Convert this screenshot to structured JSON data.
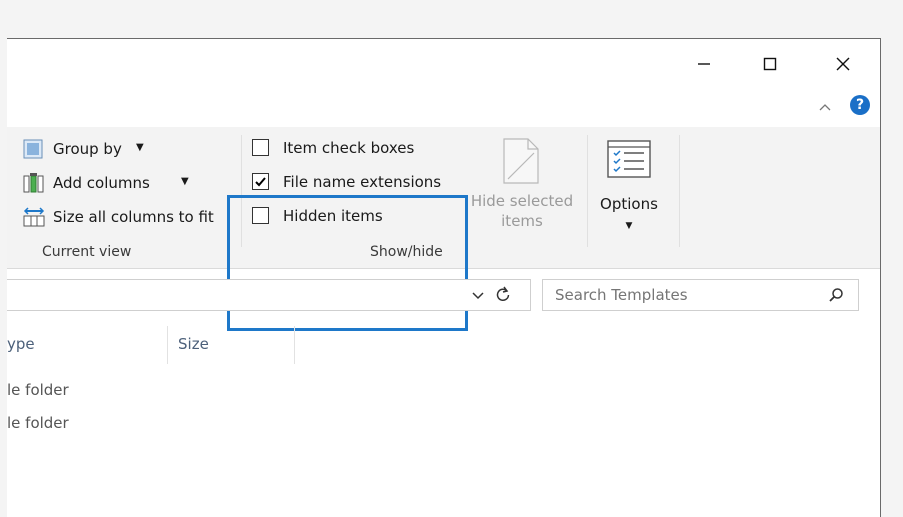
{
  "window": {
    "controls": {
      "minimize": "minimize-icon",
      "maximize": "maximize-icon",
      "close": "close-icon"
    },
    "collapse_icon": "chevron-up-icon",
    "help_icon": "?"
  },
  "ribbon": {
    "current_view": {
      "group_by": "Group by",
      "add_columns": "Add columns",
      "size_all": "Size all columns to fit",
      "label": "Current view"
    },
    "show_hide": {
      "item_check_boxes": {
        "label": "Item check boxes",
        "checked": false
      },
      "file_name_extensions": {
        "label": "File name extensions",
        "checked": true
      },
      "hidden_items": {
        "label": "Hidden items",
        "checked": false
      },
      "hide_selected_line1": "Hide selected",
      "hide_selected_line2": "items",
      "label": "Show/hide"
    },
    "options": {
      "label": "Options"
    }
  },
  "address_bar": {
    "refresh_icon": "refresh-icon",
    "dropdown_icon": "chevron-down-icon"
  },
  "search": {
    "placeholder": "Search Templates",
    "icon": "search-icon"
  },
  "columns": {
    "type": "ype",
    "size": "Size"
  },
  "rows": [
    {
      "type": "le folder"
    },
    {
      "type": "le folder"
    }
  ],
  "colors": {
    "highlight": "#1e78c9",
    "help": "#1a6fc7"
  }
}
